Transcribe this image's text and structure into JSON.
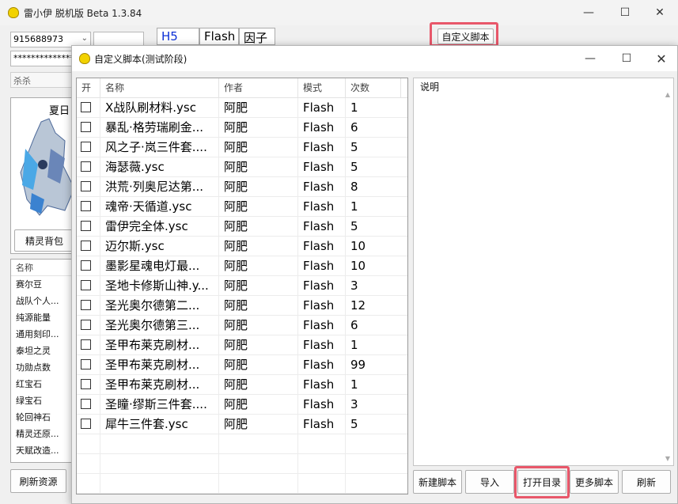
{
  "main": {
    "title": "雷小伊 脱机版 Beta 1.3.84",
    "account": "915688973",
    "password": "**************",
    "server": "杀杀",
    "mode_tabs": [
      "H5",
      "Flash",
      "因子"
    ],
    "custom_script_btn": "自定义脚本",
    "pet_name": "夏日",
    "pet_bag_btn": "精灵背包",
    "resource_header": "名称",
    "resources": [
      "赛尔豆",
      "战队个人...",
      "纯源能量",
      "通用刻印...",
      "泰坦之灵",
      "功勋点数",
      "红宝石",
      "绿宝石",
      "轮回神石",
      "精灵还原...",
      "天赋改造..."
    ],
    "refresh_resources_btn": "刷新资源",
    "window_controls": {
      "minimize": "—",
      "maximize": "☐",
      "close": "✕"
    }
  },
  "dialog": {
    "title": "自定义脚本(测试阶段)",
    "columns": [
      "开",
      "名称",
      "作者",
      "模式",
      "次数"
    ],
    "rows": [
      {
        "name": "X战队刷材料.ysc",
        "author": "阿肥",
        "mode": "Flash",
        "count": "1"
      },
      {
        "name": "暴乱·格劳瑞刷金...",
        "author": "阿肥",
        "mode": "Flash",
        "count": "6"
      },
      {
        "name": "风之子·岚三件套....",
        "author": "阿肥",
        "mode": "Flash",
        "count": "5"
      },
      {
        "name": "海瑟薇.ysc",
        "author": "阿肥",
        "mode": "Flash",
        "count": "5"
      },
      {
        "name": "洪荒·列奥尼达第...",
        "author": "阿肥",
        "mode": "Flash",
        "count": "8"
      },
      {
        "name": "魂帝·天循道.ysc",
        "author": "阿肥",
        "mode": "Flash",
        "count": "1"
      },
      {
        "name": "雷伊完全体.ysc",
        "author": "阿肥",
        "mode": "Flash",
        "count": "5"
      },
      {
        "name": "迈尔斯.ysc",
        "author": "阿肥",
        "mode": "Flash",
        "count": "10"
      },
      {
        "name": "墨影星魂电灯最...",
        "author": "阿肥",
        "mode": "Flash",
        "count": "10"
      },
      {
        "name": "圣地卡修斯山神.y...",
        "author": "阿肥",
        "mode": "Flash",
        "count": "3"
      },
      {
        "name": "圣光奥尔德第二...",
        "author": "阿肥",
        "mode": "Flash",
        "count": "12"
      },
      {
        "name": "圣光奥尔德第三...",
        "author": "阿肥",
        "mode": "Flash",
        "count": "6"
      },
      {
        "name": "圣甲布莱克刷材...",
        "author": "阿肥",
        "mode": "Flash",
        "count": "1"
      },
      {
        "name": "圣甲布莱克刷材...",
        "author": "阿肥",
        "mode": "Flash",
        "count": "99"
      },
      {
        "name": "圣甲布莱克刷材...",
        "author": "阿肥",
        "mode": "Flash",
        "count": "1"
      },
      {
        "name": "圣瞳·缪斯三件套....",
        "author": "阿肥",
        "mode": "Flash",
        "count": "3"
      },
      {
        "name": "犀牛三件套.ysc",
        "author": "阿肥",
        "mode": "Flash",
        "count": "5"
      }
    ],
    "description_label": "说明",
    "buttons": [
      "新建脚本",
      "导入",
      "打开目录",
      "更多脚本",
      "刷新"
    ]
  }
}
